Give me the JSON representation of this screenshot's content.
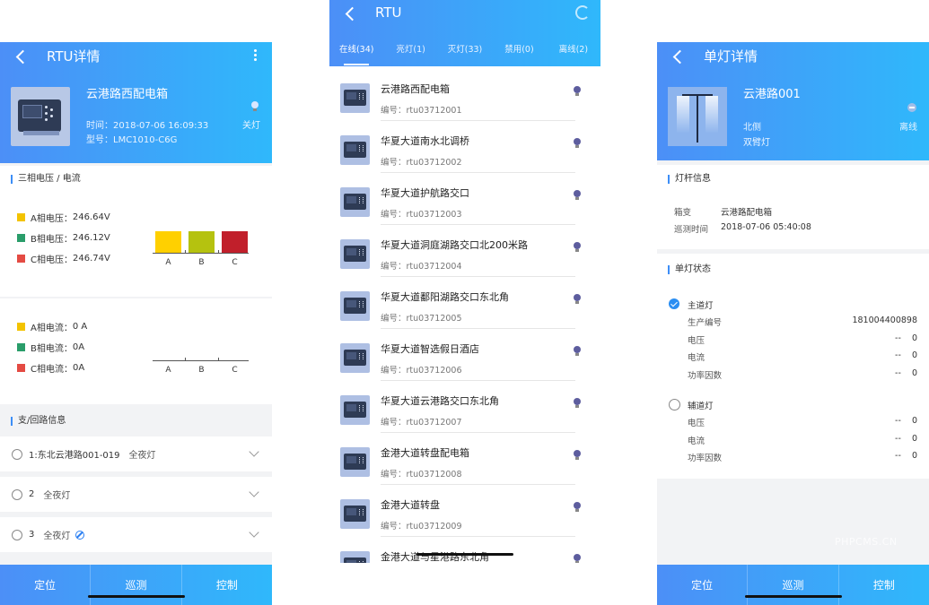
{
  "screen1": {
    "title": "RTU详情",
    "header": {
      "name": "云港路西配电箱",
      "time": "时间：2018-07-06 16:09:33",
      "model": "型号：LMC1010-C6G",
      "lamp_status": "关灯"
    },
    "three_phase": {
      "section_title": "三相电压 / 电流",
      "voltages": [
        {
          "label": "A相电压：",
          "value": "246.64V",
          "color": "#f3c300"
        },
        {
          "label": "B相电压：",
          "value": "246.12V",
          "color": "#2a9d6a"
        },
        {
          "label": "C相电压：",
          "value": "246.74V",
          "color": "#e44b43"
        }
      ],
      "currents": [
        {
          "label": "A相电流：",
          "value": "0 A",
          "color": "#f3c300"
        },
        {
          "label": "B相电流：",
          "value": "0A",
          "color": "#2a9d6a"
        },
        {
          "label": "C相电流：",
          "value": "0A",
          "color": "#e44b43"
        }
      ]
    },
    "chart_data": [
      {
        "type": "bar",
        "categories": [
          "A",
          "B",
          "C"
        ],
        "values": [
          246.64,
          246.12,
          246.74
        ],
        "colors": [
          "#ffd000",
          "#b5c20f",
          "#c11f2b"
        ],
        "title": "",
        "xlabel": "",
        "ylabel": ""
      },
      {
        "type": "bar",
        "categories": [
          "A",
          "B",
          "C"
        ],
        "values": [
          0,
          0,
          0
        ],
        "title": "",
        "xlabel": "",
        "ylabel": ""
      }
    ],
    "branch": {
      "section_title": "支/回路信息",
      "items": [
        {
          "label": "1:东北云港路001-019",
          "mode": "全夜灯",
          "disabled": false
        },
        {
          "label": "2",
          "mode": "全夜灯",
          "disabled": false
        },
        {
          "label": "3",
          "mode": "全夜灯",
          "disabled": true
        }
      ]
    },
    "bottom": [
      "定位",
      "巡测",
      "控制"
    ]
  },
  "screen2": {
    "title": "RTU",
    "tabs": [
      "在线(34)",
      "亮灯(1)",
      "灭灯(33)",
      "禁用(0)",
      "离线(2)"
    ],
    "items": [
      {
        "name": "云港路西配电箱",
        "code": "编号：rtu03712001"
      },
      {
        "name": "华夏大道南水北调桥",
        "code": "编号：rtu03712002"
      },
      {
        "name": "华夏大道护航路交口",
        "code": "编号：rtu03712003"
      },
      {
        "name": "华夏大道洞庭湖路交口北200米路",
        "code": "编号：rtu03712004"
      },
      {
        "name": "华夏大道鄱阳湖路交口东北角",
        "code": "编号：rtu03712005"
      },
      {
        "name": "华夏大道智选假日酒店",
        "code": "编号：rtu03712006"
      },
      {
        "name": "华夏大道云港路交口东北角",
        "code": "编号：rtu03712007"
      },
      {
        "name": "金港大道转盘配电箱",
        "code": "编号：rtu03712008"
      },
      {
        "name": "金港大道转盘",
        "code": "编号：rtu03712009"
      },
      {
        "name": "金港大道与星港路东北角",
        "code": ""
      }
    ]
  },
  "screen3": {
    "title": "单灯详情",
    "header": {
      "name": "云港路001",
      "side": "北侧",
      "type": "双臂灯",
      "status": "离线"
    },
    "pole_info": {
      "section_title": "灯杆信息",
      "rows": [
        {
          "key": "箱变",
          "value": "云港路配电箱"
        },
        {
          "key": "巡测时间",
          "value": "2018-07-06 05:40:08"
        }
      ]
    },
    "lamp_state": {
      "section_title": "单灯状态",
      "main": {
        "label": "主道灯",
        "rows": [
          {
            "key": "生产编号",
            "value": "181004400898"
          },
          {
            "key": "电压",
            "value": "--    0"
          },
          {
            "key": "电流",
            "value": "--    0"
          },
          {
            "key": "功率因数",
            "value": "--    0"
          }
        ]
      },
      "aux": {
        "label": "辅道灯",
        "rows": [
          {
            "key": "电压",
            "value": "--    0"
          },
          {
            "key": "电流",
            "value": "--    0"
          },
          {
            "key": "功率因数",
            "value": "--    0"
          }
        ]
      }
    },
    "bottom": [
      "定位",
      "巡测",
      "控制"
    ]
  },
  "watermark": "PHPCMS.CN"
}
